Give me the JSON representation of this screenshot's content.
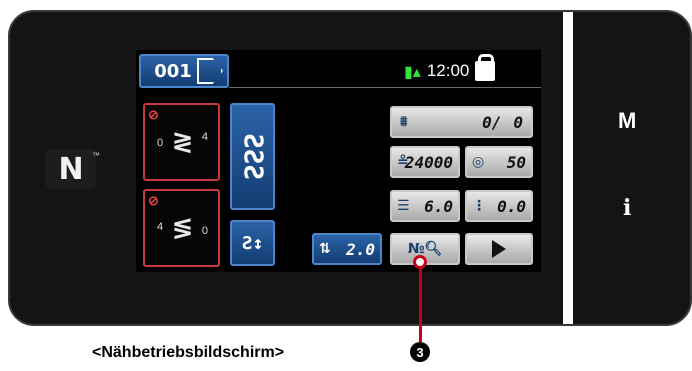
{
  "colors": {
    "panel": "#141414",
    "tile_blue": "#1f4f8c",
    "tile_grey": "#c9c9c9",
    "warning_red": "#c63a3a",
    "antenna_green": "#2ee640",
    "callout_red": "#c8001a"
  },
  "nfc_mark": "N",
  "pattern_number": "001",
  "status": {
    "time": "12:00",
    "antenna_icon": "antenna-signal-icon",
    "lock_icon": "lock-open-icon"
  },
  "counter": {
    "value": "0/",
    "limit": "0"
  },
  "speed": {
    "value": "4000",
    "prefix": "2"
  },
  "tension": {
    "value": "50"
  },
  "stitch_length": {
    "value": "6.0"
  },
  "stitch_width": {
    "value": "0.0"
  },
  "pitch": {
    "value": "2.0"
  },
  "side_buttons": {
    "menu": "M",
    "info": "i"
  },
  "sew_markers": {
    "bottom_from": "0",
    "bottom_to": "4",
    "top_from": "4",
    "top_to": "0"
  },
  "callout_number": "3",
  "caption": "<Nähbetriebsbildschirm>"
}
